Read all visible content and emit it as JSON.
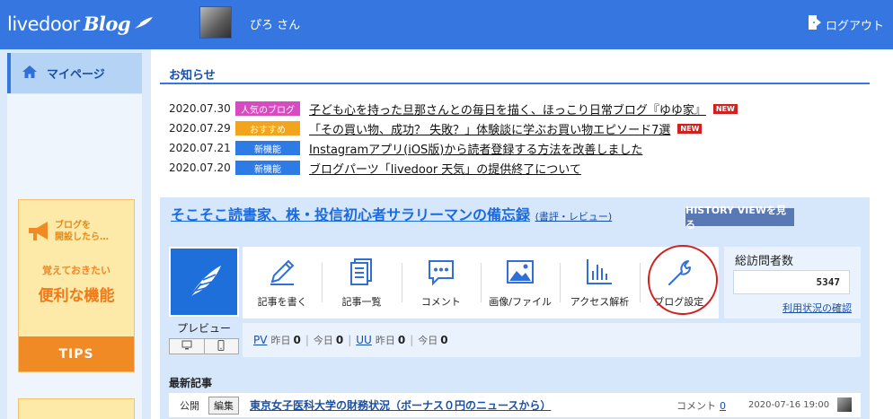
{
  "header": {
    "logo_text": "livedoor",
    "logo_blog": "Blog",
    "username": "ぴろ さん",
    "logout_label": "ログアウト",
    "brand_color": "#3676e0"
  },
  "sidebar": {
    "mypage_label": "マイページ",
    "tips_banner": {
      "sub_line1": "ブログを",
      "sub_line2": "開設したら…",
      "line1": "覚えておきたい",
      "line2": "便利な機能",
      "bottom": "TIPS"
    }
  },
  "news": {
    "title": "お知らせ",
    "items": [
      {
        "date": "2020.07.30",
        "tag": "人気のブログ",
        "tag_color": "#d64bc0",
        "text": "子ども心を持った旦那さんとの毎日を描く、ほっこり日常ブログ『ゆゆ家』",
        "new": "NEW"
      },
      {
        "date": "2020.07.29",
        "tag": "おすすめ",
        "tag_color": "#f2a51c",
        "text": "「その買い物、成功？ 失敗？」体験談に学ぶお買い物エピソード7選",
        "new": "NEW"
      },
      {
        "date": "2020.07.21",
        "tag": "新機能",
        "tag_color": "#2f7be6",
        "text": "Instagramアプリ(iOS版)から読者登録する方法を改善しました",
        "new": ""
      },
      {
        "date": "2020.07.20",
        "tag": "新機能",
        "tag_color": "#2f7be6",
        "text": "ブログパーツ「livedoor 天気」の提供終了について",
        "new": ""
      }
    ]
  },
  "blog": {
    "title": "そこそこ読書家、株・投信初心者サラリーマンの備忘録",
    "category": "(書評・レビュー)",
    "history_button": "HISTORY VIEWを見る",
    "preview_label": "プレビュー",
    "actions": [
      {
        "icon": "pencil-icon",
        "label": "記事を書く"
      },
      {
        "icon": "document-list-icon",
        "label": "記事一覧"
      },
      {
        "icon": "comment-icon",
        "label": "コメント"
      },
      {
        "icon": "image-icon",
        "label": "画像/ファイル"
      },
      {
        "icon": "bar-chart-icon",
        "label": "アクセス解析"
      },
      {
        "icon": "wrench-icon",
        "label": "ブログ設定"
      }
    ],
    "stats": {
      "label": "総訪問者数",
      "value": "5347",
      "link": "利用状況の確認"
    },
    "pv": {
      "pv_label": "PV",
      "yesterday_label": "昨日",
      "yesterday_pv": "0",
      "today_label": "今日",
      "today_pv": "0",
      "uu_label": "UU",
      "yesterday_uu": "0",
      "today_uu": "0"
    },
    "latest": {
      "title": "最新記事",
      "items": [
        {
          "status": "公開",
          "edit_label": "編集",
          "title": "東京女子医科大学の財務状況（ボーナス０円のニュースから）",
          "comment_label": "コメント",
          "comment_count": "0",
          "date": "2020-07-16 19:00"
        }
      ]
    }
  }
}
